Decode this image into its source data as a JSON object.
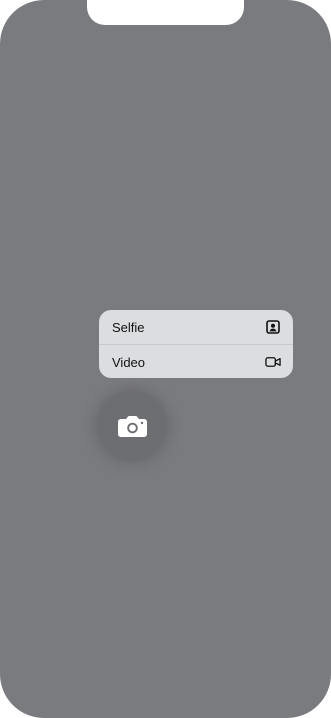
{
  "menu": {
    "items": [
      {
        "label": "Selfie",
        "icon": "selfie-portrait-icon"
      },
      {
        "label": "Video",
        "icon": "video-camera-icon"
      }
    ]
  },
  "camera_button": {
    "icon": "camera-icon"
  },
  "colors": {
    "overlay": "#7a7b7f",
    "menu_background": "#dcdde0",
    "text": "#111111",
    "fab": "#6d6e72"
  }
}
